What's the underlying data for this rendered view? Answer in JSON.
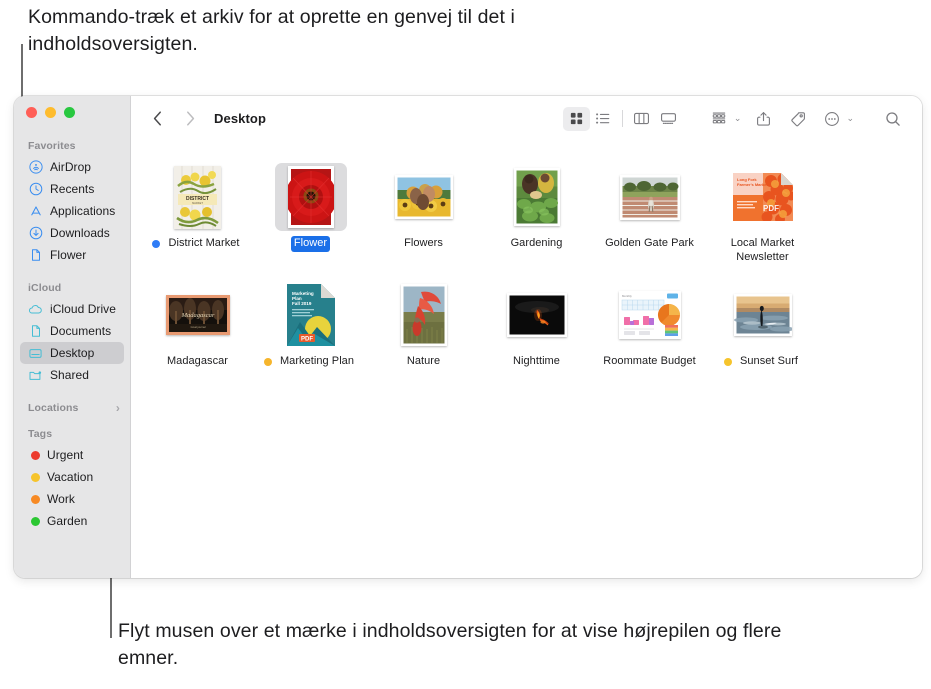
{
  "callouts": {
    "top": "Kommando-træk et arkiv for at oprette en genvej til det i indholdsoversigten.",
    "bottom": "Flyt musen over et mærke i indholdsoversigten for at vise højrepilen og flere emner."
  },
  "window": {
    "traffic_lights": {
      "close_label": "close",
      "minimize_label": "minimize",
      "zoom_label": "zoom",
      "close_color": "#ff5f57",
      "minimize_color": "#febc2e",
      "zoom_color": "#28c840"
    }
  },
  "toolbar": {
    "back_label": "‹",
    "forward_label": "›",
    "title": "Desktop",
    "view_icon_label": "Vis som symboler",
    "view_list_label": "Vis som liste",
    "view_column_label": "Vis som kolonner",
    "view_gallery_label": "Vis som galleri",
    "group_label": "Gruppér",
    "share_label": "Del",
    "tags_label": "Mærker",
    "more_label": "Flere handlinger",
    "search_label": "Søg",
    "caret": "⌄"
  },
  "sidebar": {
    "sections": [
      {
        "title": "Favorites",
        "has_chevron": false,
        "items": [
          {
            "label": "AirDrop",
            "icon": "airdrop-icon",
            "selected": false
          },
          {
            "label": "Recents",
            "icon": "clock-icon",
            "selected": false
          },
          {
            "label": "Applications",
            "icon": "appstore-icon",
            "selected": false
          },
          {
            "label": "Downloads",
            "icon": "download-icon",
            "selected": false
          },
          {
            "label": "Flower",
            "icon": "document-icon",
            "selected": false
          }
        ]
      },
      {
        "title": "iCloud",
        "has_chevron": false,
        "items": [
          {
            "label": "iCloud Drive",
            "icon": "cloud-icon",
            "selected": false
          },
          {
            "label": "Documents",
            "icon": "document-teal-icon",
            "selected": false
          },
          {
            "label": "Desktop",
            "icon": "desktop-icon",
            "selected": true
          },
          {
            "label": "Shared",
            "icon": "shared-folder-icon",
            "selected": false
          }
        ]
      },
      {
        "title": "Locations",
        "has_chevron": true,
        "chevron": "›",
        "items": []
      },
      {
        "title": "Tags",
        "has_chevron": false,
        "items": [
          {
            "label": "Urgent",
            "icon": "tag-dot",
            "color": "#ec3b2e",
            "selected": false
          },
          {
            "label": "Vacation",
            "icon": "tag-dot",
            "color": "#f6c42c",
            "selected": false
          },
          {
            "label": "Work",
            "icon": "tag-dot",
            "color": "#f78a24",
            "selected": false
          },
          {
            "label": "Garden",
            "icon": "tag-dot",
            "color": "#2bc732",
            "selected": false
          }
        ]
      }
    ]
  },
  "files": [
    {
      "name": "District Market",
      "kind": "poster",
      "tag_color": "#2f7cf6",
      "selected": false
    },
    {
      "name": "Flower",
      "kind": "flower",
      "tag_color": null,
      "selected": true
    },
    {
      "name": "Flowers",
      "kind": "sunflowers",
      "tag_color": null,
      "selected": false
    },
    {
      "name": "Gardening",
      "kind": "gardening",
      "tag_color": null,
      "selected": false
    },
    {
      "name": "Golden Gate Park",
      "kind": "track",
      "tag_color": null,
      "selected": false
    },
    {
      "name": "Local Market Newsletter",
      "kind": "pdf-market",
      "tag_color": null,
      "selected": false
    },
    {
      "name": "Madagascar",
      "kind": "madagascar",
      "tag_color": null,
      "selected": false
    },
    {
      "name": "Marketing Plan",
      "kind": "pdf-marketing",
      "tag_color": "#f6b52c",
      "selected": false
    },
    {
      "name": "Nature",
      "kind": "nature",
      "tag_color": null,
      "selected": false
    },
    {
      "name": "Nighttime",
      "kind": "nighttime",
      "tag_color": null,
      "selected": false
    },
    {
      "name": "Roommate Budget",
      "kind": "spreadsheet",
      "tag_color": null,
      "selected": false
    },
    {
      "name": "Sunset Surf",
      "kind": "surf",
      "tag_color": "#f6c42c",
      "selected": false
    }
  ]
}
